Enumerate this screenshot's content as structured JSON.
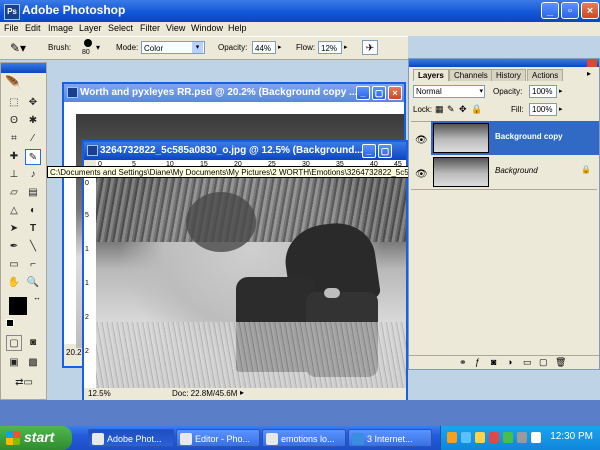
{
  "app": {
    "title": "Adobe Photoshop",
    "icon_label": "Ps"
  },
  "menu": [
    "File",
    "Edit",
    "Image",
    "Layer",
    "Select",
    "Filter",
    "View",
    "Window",
    "Help"
  ],
  "options_bar": {
    "brush_label": "Brush:",
    "brush_size": "80",
    "mode_label": "Mode:",
    "mode_value": "Color",
    "opacity_label": "Opacity:",
    "opacity_value": "44%",
    "flow_label": "Flow:",
    "flow_value": "12%"
  },
  "documents": {
    "back": {
      "title": "Worth and pyxleyes RR.psd @ 20.2% (Background copy ...",
      "zoom": "20.2"
    },
    "front": {
      "title": "3264732822_5c585a0830_o.jpg @ 12.5% (Background...",
      "zoom": "12.5%",
      "doc_info": "Doc: 22.8M/45.6M",
      "ruler_ticks": [
        "0",
        "5",
        "10",
        "15",
        "20",
        "25",
        "30",
        "35",
        "40",
        "45"
      ],
      "ruler_v_ticks": [
        "0",
        "5",
        "1",
        "1",
        "2",
        "2"
      ]
    }
  },
  "tooltip": "C:\\Documents and Settings\\Diane\\My Documents\\My Pictures\\2 WORTH\\Emotions\\3264732822_5c585a0830_o.jpg @ 12.5% (Background copy, RGB/8)",
  "layers_panel": {
    "tabs": [
      "Layers",
      "Channels",
      "History",
      "Actions"
    ],
    "blend_mode": "Normal",
    "opacity_label": "Opacity:",
    "opacity_value": "100%",
    "lock_label": "Lock:",
    "fill_label": "Fill:",
    "fill_value": "100%",
    "layers": [
      {
        "name": "Background copy",
        "selected": true
      },
      {
        "name": "Background",
        "selected": false
      }
    ]
  },
  "taskbar": {
    "start_label": "start",
    "tasks": [
      "Adobe Phot...",
      "Editor - Pho...",
      "emotions lo...",
      "3 Internet..."
    ],
    "clock": "12:30 PM"
  },
  "colors": {
    "xp_blue": "#0c45c0",
    "selected_layer": "#316ac5",
    "tooltip_bg": "#ffffe1"
  }
}
